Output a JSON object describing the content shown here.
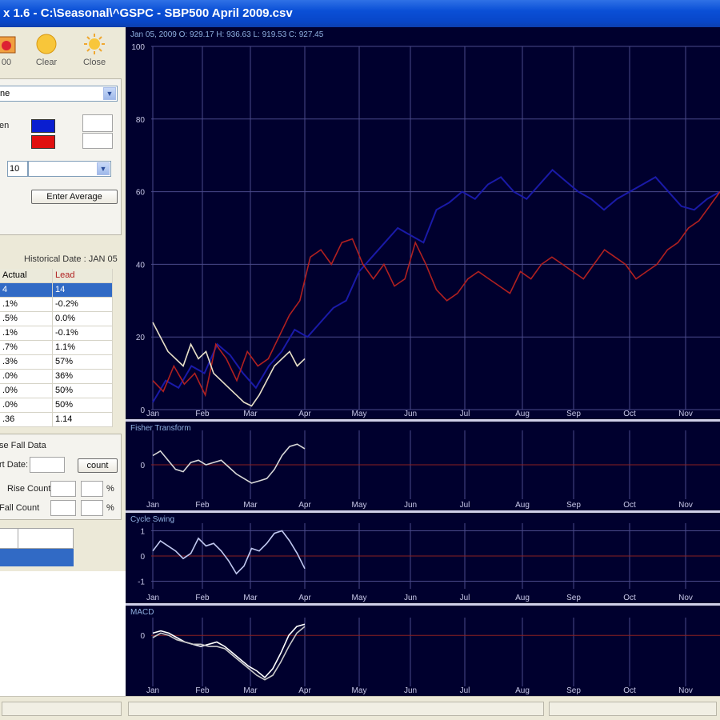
{
  "window": {
    "title": "x 1.6 - C:\\Seasonal\\^GSPC - SBP500 April 2009.csv"
  },
  "toolbar": {
    "buttons": [
      {
        "label": "00",
        "icon": "calendar-icon"
      },
      {
        "label": "Clear",
        "icon": "sun-icon"
      },
      {
        "label": "Close",
        "icon": "sun-small-icon"
      }
    ]
  },
  "settings": {
    "combo_value": "ne",
    "color_label_1": "en",
    "color_label_2": "",
    "color_1": "#0a1ed0",
    "color_2": "#e01010",
    "period_value": "10",
    "button_label": "Enter Average"
  },
  "grid": {
    "caption": "Historical Date : JAN 05",
    "columns": [
      "Actual",
      "Lead"
    ],
    "rows": [
      [
        "4",
        "14"
      ],
      [
        ".1%",
        "-0.2%"
      ],
      [
        ".5%",
        "0.0%"
      ],
      [
        ".1%",
        "-0.1%"
      ],
      [
        ".7%",
        "1.1%"
      ],
      [
        ".3%",
        "57%"
      ],
      [
        ".0%",
        "36%"
      ],
      [
        ".0%",
        "50%"
      ],
      [
        ".0%",
        "50%"
      ],
      [
        ".36",
        "1.14"
      ]
    ]
  },
  "rise_fall": {
    "title": "se Fall Data",
    "date_label": "rt Date:",
    "count_button": "count",
    "rise_label": "Rise Count",
    "fall_label": "Fall Count",
    "pct_label": "%"
  },
  "chart_data": [
    {
      "type": "line",
      "panel": "price",
      "header": "Jan 05, 2009  O: 929.17  H: 936.63  L: 919.53  C: 927.45",
      "x_labels": [
        "Jan",
        "Feb",
        "Mar",
        "Apr",
        "May",
        "Jun",
        "Jul",
        "Aug",
        "Sep",
        "Oct",
        "Nov"
      ],
      "y_ticks": [
        "100",
        "80",
        "60",
        "40",
        "20",
        "0"
      ],
      "ylim": [
        0,
        100
      ],
      "series": [
        {
          "color": "#1a1aa8",
          "values": [
            2,
            8,
            6,
            12,
            10,
            18,
            15,
            10,
            6,
            12,
            16,
            22,
            20,
            24,
            28,
            30,
            38,
            42,
            46,
            50,
            48,
            46,
            55,
            57,
            60,
            58,
            62,
            64,
            60,
            58,
            62,
            66,
            63,
            60,
            58,
            55,
            58,
            60,
            62,
            64,
            60,
            56,
            55,
            58,
            60
          ]
        },
        {
          "color": "#b02020",
          "values": [
            8,
            5,
            12,
            7,
            10,
            4,
            18,
            14,
            8,
            16,
            12,
            14,
            20,
            26,
            30,
            42,
            44,
            40,
            46,
            47,
            40,
            36,
            40,
            34,
            36,
            46,
            40,
            33,
            30,
            32,
            36,
            38,
            36,
            34,
            32,
            38,
            36,
            40,
            42,
            40,
            38,
            36,
            40,
            44,
            42,
            40,
            36,
            38,
            40,
            44,
            46,
            50,
            52,
            56,
            60
          ]
        },
        {
          "color": "#e8e0c8",
          "values": [
            24,
            20,
            16,
            14,
            12,
            18,
            14,
            16,
            10,
            8,
            6,
            4,
            2,
            1,
            4,
            8,
            12,
            14,
            16,
            12,
            14
          ]
        }
      ]
    },
    {
      "type": "line",
      "panel": "osc1",
      "header": "Fisher Transform",
      "x_labels": [
        "Jan",
        "Feb",
        "Mar",
        "Apr",
        "May",
        "Jun",
        "Jul",
        "Aug",
        "Sep",
        "Oct",
        "Nov"
      ],
      "y_ticks": [
        "0"
      ],
      "series": [
        {
          "color": "#d8d8d8",
          "values": [
            0.4,
            0.6,
            0.2,
            -0.2,
            -0.3,
            0.1,
            0.2,
            0.0,
            0.1,
            0.2,
            -0.1,
            -0.4,
            -0.6,
            -0.8,
            -0.7,
            -0.6,
            -0.2,
            0.4,
            0.8,
            0.9,
            0.7
          ]
        }
      ]
    },
    {
      "type": "line",
      "panel": "osc2",
      "header": "Cycle Swing",
      "x_labels": [
        "Jan",
        "Feb",
        "Mar",
        "Apr",
        "May",
        "Jun",
        "Jul",
        "Aug",
        "Sep",
        "Oct",
        "Nov"
      ],
      "y_ticks": [
        "1",
        "0",
        "-1"
      ],
      "series": [
        {
          "color": "#c0c8f0",
          "values": [
            0.2,
            0.6,
            0.4,
            0.2,
            -0.1,
            0.1,
            0.7,
            0.4,
            0.5,
            0.2,
            -0.2,
            -0.7,
            -0.4,
            0.3,
            0.2,
            0.5,
            0.9,
            1.0,
            0.6,
            0.1,
            -0.5
          ]
        }
      ]
    },
    {
      "type": "line",
      "panel": "macd",
      "header": "MACD",
      "x_labels": [
        "Jan",
        "Feb",
        "Mar",
        "Apr",
        "May",
        "Jun",
        "Jul",
        "Aug",
        "Sep",
        "Oct",
        "Nov"
      ],
      "y_ticks": [
        "0"
      ],
      "series": [
        {
          "color": "#ffffff",
          "values": [
            0.1,
            0.2,
            0.1,
            -0.1,
            -0.3,
            -0.4,
            -0.5,
            -0.4,
            -0.3,
            -0.5,
            -0.8,
            -1.1,
            -1.4,
            -1.6,
            -1.9,
            -1.5,
            -0.8,
            0.0,
            0.4,
            0.5
          ]
        },
        {
          "color": "#c8c8c8",
          "values": [
            -0.1,
            0.1,
            0.0,
            -0.2,
            -0.3,
            -0.4,
            -0.4,
            -0.5,
            -0.5,
            -0.6,
            -0.9,
            -1.2,
            -1.5,
            -1.8,
            -2.0,
            -1.8,
            -1.2,
            -0.5,
            0.1,
            0.4
          ]
        }
      ]
    }
  ]
}
